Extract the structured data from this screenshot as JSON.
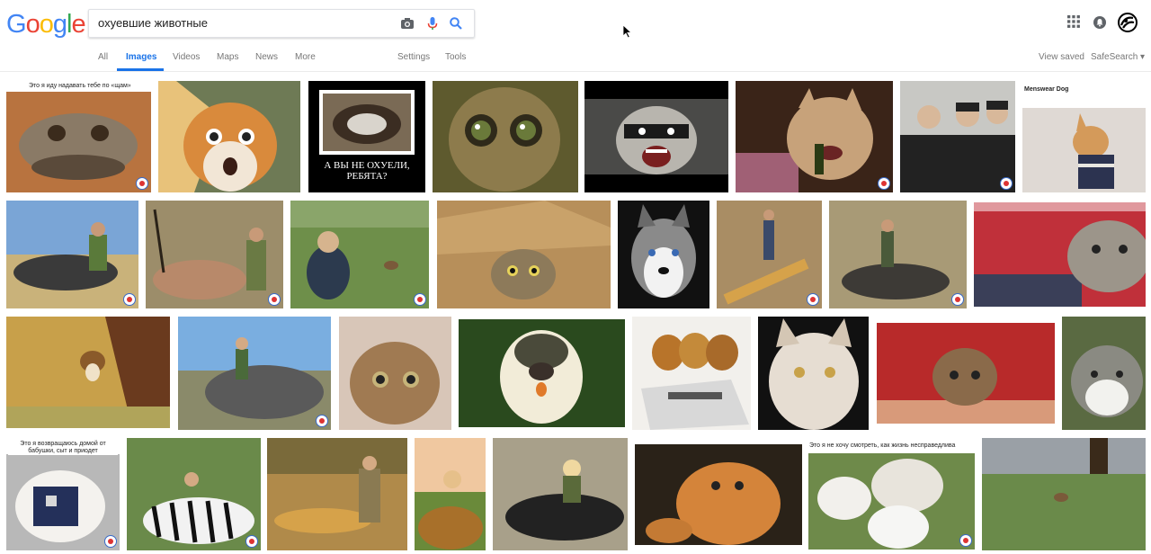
{
  "logo": {
    "letters": [
      "G",
      "o",
      "o",
      "g",
      "l",
      "e"
    ],
    "colors": [
      "#4285F4",
      "#EA4335",
      "#FBBC05",
      "#4285F4",
      "#34A853",
      "#EA4335"
    ]
  },
  "search": {
    "query": "охуевшие животные"
  },
  "nav": {
    "tabs": [
      {
        "label": "All",
        "active": false
      },
      {
        "label": "Images",
        "active": true
      },
      {
        "label": "Videos",
        "active": false
      },
      {
        "label": "Maps",
        "active": false
      },
      {
        "label": "News",
        "active": false
      },
      {
        "label": "More",
        "active": false
      }
    ],
    "settings": "Settings",
    "tools": "Tools",
    "view_saved": "View saved",
    "safesearch": "SafeSearch ▾"
  },
  "results": {
    "captions": {
      "toad": "Это я иду надавать тебе по «щам»",
      "demotivator": "А ВЫ НЕ ОХУЕЛИ, РЕБЯТА?",
      "menswear": "Menswear Dog",
      "grandma": "Это я возвращаюсь домой от бабушки, сыт и приодет",
      "watch": "Это я не хочу смотреть, как жизнь несправедлива"
    }
  },
  "colors": {
    "accent": "#1a73e8",
    "nav_text": "#777777",
    "border": "#ebebeb"
  }
}
